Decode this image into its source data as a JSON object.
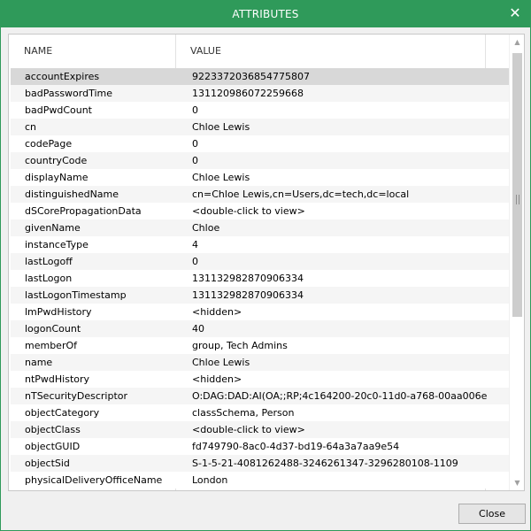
{
  "window": {
    "title": "ATTRIBUTES",
    "close_glyph": "✕"
  },
  "table": {
    "columns": [
      "NAME",
      "VALUE"
    ],
    "selected_index": 0,
    "rows": [
      {
        "name": "accountExpires",
        "value": "9223372036854775807"
      },
      {
        "name": "badPasswordTime",
        "value": "131120986072259668"
      },
      {
        "name": "badPwdCount",
        "value": "0"
      },
      {
        "name": "cn",
        "value": "Chloe Lewis"
      },
      {
        "name": "codePage",
        "value": "0"
      },
      {
        "name": "countryCode",
        "value": "0"
      },
      {
        "name": "displayName",
        "value": "Chloe Lewis"
      },
      {
        "name": "distinguishedName",
        "value": "cn=Chloe Lewis,cn=Users,dc=tech,dc=local"
      },
      {
        "name": "dSCorePropagationData",
        "value": "<double-click to view>"
      },
      {
        "name": "givenName",
        "value": "Chloe"
      },
      {
        "name": "instanceType",
        "value": "4"
      },
      {
        "name": "lastLogoff",
        "value": "0"
      },
      {
        "name": "lastLogon",
        "value": "131132982870906334"
      },
      {
        "name": "lastLogonTimestamp",
        "value": "131132982870906334"
      },
      {
        "name": "lmPwdHistory",
        "value": "<hidden>"
      },
      {
        "name": "logonCount",
        "value": "40"
      },
      {
        "name": "memberOf",
        "value": "group, Tech Admins"
      },
      {
        "name": "name",
        "value": "Chloe Lewis"
      },
      {
        "name": "ntPwdHistory",
        "value": "<hidden>"
      },
      {
        "name": "nTSecurityDescriptor",
        "value": "O:DAG:DAD:AI(OA;;RP;4c164200-20c0-11d0-a768-00aa006e"
      },
      {
        "name": "objectCategory",
        "value": "classSchema, Person"
      },
      {
        "name": "objectClass",
        "value": "<double-click to view>"
      },
      {
        "name": "objectGUID",
        "value": "fd749790-8ac0-4d37-bd19-64a3a7aa9e54"
      },
      {
        "name": "objectSid",
        "value": "S-1-5-21-4081262488-3246261347-3296280108-1109"
      },
      {
        "name": "physicalDeliveryOfficeName",
        "value": "London"
      }
    ]
  },
  "footer": {
    "close_label": "Close"
  },
  "colors": {
    "accent": "#2f9a5a",
    "selected_row": "#d8d8d8"
  },
  "icons": {
    "scroll_up": "scroll-up-arrow-icon",
    "scroll_down": "scroll-down-arrow-icon",
    "close": "close-icon"
  }
}
